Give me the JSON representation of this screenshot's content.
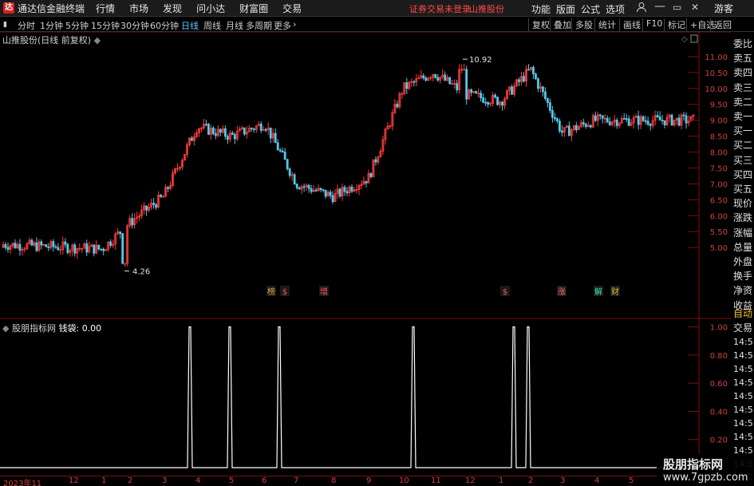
{
  "app": {
    "name": "通达信金融终端",
    "logo": "tdx-logo"
  },
  "menu": [
    "行情",
    "市场",
    "发现",
    "问小达",
    "财富圈",
    "交易"
  ],
  "notice": {
    "text": "证券交易未登录",
    "stock": "山推股份"
  },
  "right_menu": [
    "功能",
    "版面",
    "公式",
    "选项"
  ],
  "window": {
    "guest_label": "游客",
    "icons": [
      "user-icon",
      "minimize-icon",
      "maximize-icon",
      "close-icon"
    ]
  },
  "periods": [
    {
      "label": "分时",
      "active": false
    },
    {
      "label": "1分钟",
      "active": false
    },
    {
      "label": "5分钟",
      "active": false
    },
    {
      "label": "15分钟",
      "active": false
    },
    {
      "label": "30分钟",
      "active": false
    },
    {
      "label": "60分钟",
      "active": false
    },
    {
      "label": "日线",
      "active": true
    },
    {
      "label": "周线",
      "active": false
    },
    {
      "label": "月线",
      "active": false
    },
    {
      "label": "多周期",
      "active": false
    },
    {
      "label": "更多",
      "active": false
    }
  ],
  "toolbar": [
    "复权",
    "叠加",
    "多股",
    "统计",
    "画线",
    "F10",
    "标记",
    "+自选",
    "返回"
  ],
  "chart_title": "山推股份(日线 前复权)",
  "price_axis": [
    "11.00",
    "10.50",
    "10.00",
    "9.50",
    "9.00",
    "8.50",
    "8.00",
    "7.50",
    "7.00",
    "6.50",
    "6.00",
    "5.50",
    "5.00"
  ],
  "annotations": {
    "high": "10.92",
    "low": "4.26"
  },
  "event_markers": [
    "榜",
    "$",
    "增",
    "$",
    "涨",
    "解",
    "财"
  ],
  "side_labels": [
    "委比",
    "卖五",
    "卖四",
    "卖三",
    "卖二",
    "卖一",
    "买一",
    "买二",
    "买三",
    "买四",
    "买五",
    "现价",
    "涨跌",
    "涨幅",
    "总量",
    "外盘",
    "换手",
    "净资",
    "收益"
  ],
  "indicator": {
    "name": "股朋指标网",
    "value_label": "钱袋",
    "value": "0.00",
    "axis": [
      "1.00",
      "0.80",
      "0.60",
      "0.40",
      "0.20"
    ]
  },
  "side_panel2": {
    "label1": "自动",
    "label2": "交易",
    "times": [
      "14:5",
      "14:5",
      "14:5",
      "14:5",
      "14:5",
      "14:5",
      "14:5",
      "14:5",
      "14:5",
      "14:5",
      "14:5",
      "14:5"
    ]
  },
  "date_axis": [
    "2023年11",
    "12",
    "1",
    "2",
    "3",
    "4",
    "5",
    "6",
    "7",
    "8",
    "9",
    "10",
    "11",
    "12",
    "1",
    "2",
    "3",
    "4",
    "5"
  ],
  "watermark": {
    "title": "股朋指标网",
    "url": "www.7gpzb.com"
  },
  "colors": {
    "up": "#ff3c3c",
    "down": "#54c8e8",
    "frame": "#7a1010",
    "axis_text": "#d04040",
    "active": "#5cc8ff"
  },
  "chart_data": [
    {
      "type": "candlestick",
      "title": "山推股份(日线 前复权)",
      "ylim": [
        4.0,
        11.4
      ],
      "annotations": [
        {
          "label": "10.92",
          "value": 10.92
        },
        {
          "label": "4.26",
          "value": 4.26
        }
      ],
      "close_by_month": [
        {
          "month": "2023-11",
          "close": 5.1
        },
        {
          "month": "2023-12",
          "close": 5.0
        },
        {
          "month": "2024-01",
          "close": 4.95
        },
        {
          "month": "2024-02",
          "close": 5.9
        },
        {
          "month": "2024-03",
          "close": 6.6
        },
        {
          "month": "2024-04",
          "close": 8.8
        },
        {
          "month": "2024-05",
          "close": 8.5
        },
        {
          "month": "2024-06",
          "close": 8.9
        },
        {
          "month": "2024-07",
          "close": 7.0
        },
        {
          "month": "2024-08",
          "close": 6.6
        },
        {
          "month": "2024-09",
          "close": 7.2
        },
        {
          "month": "2024-10",
          "close": 10.0
        },
        {
          "month": "2024-11",
          "close": 10.5
        },
        {
          "month": "2024-12",
          "close": 9.8
        },
        {
          "month": "2025-01",
          "close": 9.6
        },
        {
          "month": "2025-02",
          "close": 10.6
        },
        {
          "month": "2025-03",
          "close": 8.6
        },
        {
          "month": "2025-04",
          "close": 9.0
        },
        {
          "month": "2025-05",
          "close": 9.0
        }
      ]
    },
    {
      "type": "line",
      "series": [
        {
          "name": "钱袋",
          "values": [
            0,
            1,
            1,
            1,
            1,
            1,
            1,
            1
          ]
        }
      ],
      "ylim": [
        0,
        1.1
      ]
    }
  ]
}
